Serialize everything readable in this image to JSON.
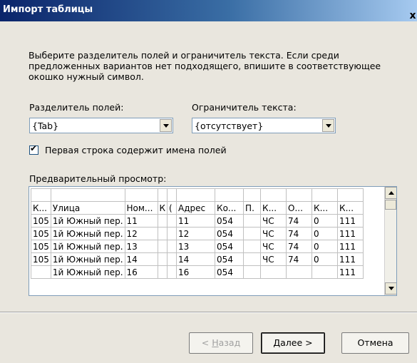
{
  "window": {
    "title": "Импорт таблицы",
    "close_glyph": "x"
  },
  "intro_text": "Выберите разделитель полей и ограничитель текста. Если среди предложенных вариантов нет подходящего, впишите в соответствующее окошко нужный символ.",
  "field_delimiter": {
    "label": "Разделитель полей:",
    "value": "{Tab}"
  },
  "text_qualifier": {
    "label": "Ограничитель текста:",
    "value": "{отсутствует}"
  },
  "first_row_names": {
    "label": "Первая строка содержит имена полей",
    "checked": true
  },
  "preview": {
    "label": "Предварительный просмотр:",
    "header": [
      "К...",
      "Улица",
      "Ном...",
      "К",
      "(",
      "Адрес",
      "Ко...",
      "П.",
      "К...",
      "О...",
      "К...",
      "К..."
    ],
    "rows": [
      [
        "105",
        "1й Южный пер.",
        "11",
        "",
        "",
        "11",
        "054",
        "",
        "ЧС",
        "74",
        "0",
        "111"
      ],
      [
        "105",
        "1й Южный пер.",
        "12",
        "",
        "",
        "12",
        "054",
        "",
        "ЧС",
        "74",
        "0",
        "111"
      ],
      [
        "105",
        "1й Южный пер.",
        "13",
        "",
        "",
        "13",
        "054",
        "",
        "ЧС",
        "74",
        "0",
        "111"
      ],
      [
        "105",
        "1й Южный пер.",
        "14",
        "",
        "",
        "14",
        "054",
        "",
        "ЧС",
        "74",
        "0",
        "111"
      ],
      [
        "",
        "1й Южный пер.",
        "16",
        "",
        "",
        "16",
        "054",
        "",
        "",
        "",
        "",
        "111"
      ]
    ]
  },
  "buttons": {
    "back_prefix": "< ",
    "back_key": "Н",
    "back_rest": "азад",
    "next_key": "Д",
    "next_rest": "алее >",
    "cancel": "Отмена"
  }
}
